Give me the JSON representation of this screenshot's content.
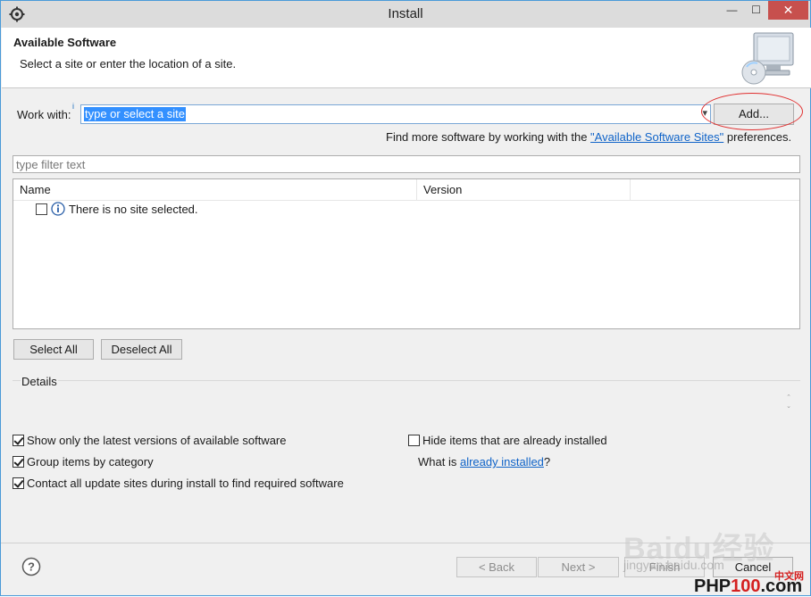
{
  "window": {
    "title": "Install",
    "min_glyph": "—",
    "max_glyph": "☐",
    "close_glyph": "✕"
  },
  "header": {
    "title": "Available Software",
    "subtitle": "Select a site or enter the location of a site."
  },
  "work_with": {
    "label": "Work with:",
    "info_glyph": "i",
    "value": "type or select a site",
    "arrow_glyph": "▾",
    "add_label": "Add..."
  },
  "find_more": {
    "prefix": "Find more software by working with the ",
    "link": "\"Available Software Sites\"",
    "suffix": " preferences."
  },
  "filter": {
    "placeholder": "type filter text"
  },
  "table": {
    "columns": [
      "Name",
      "Version"
    ],
    "rows": [
      {
        "text": "There is no site selected.",
        "checked": false,
        "icon": "info-icon"
      }
    ]
  },
  "selection_buttons": {
    "select_all": "Select All",
    "deselect_all": "Deselect All"
  },
  "details": {
    "label": "Details",
    "scroll_up": "⌃",
    "scroll_down": "⌄"
  },
  "options": {
    "latest_only": {
      "label": "Show only the latest versions of available software",
      "checked": true
    },
    "group_by_category": {
      "label": "Group items by category",
      "checked": true
    },
    "contact_sites": {
      "label": "Contact all update sites during install to find required software",
      "checked": true
    },
    "hide_installed": {
      "label": "Hide items that are already installed",
      "checked": false
    },
    "what_is": {
      "prefix": "What is ",
      "link": "already installed",
      "suffix": "?"
    }
  },
  "footer": {
    "help_glyph": "?",
    "back": "< Back",
    "next": "Next >",
    "finish": "Finish",
    "cancel": "Cancel"
  },
  "watermarks": {
    "baidu": "Baidu经验",
    "jingyan": "jingyan.baidu.com",
    "php_prefix": "PHP",
    "php_number": "100",
    "php_suffix": ".com",
    "php_cn": "中文网"
  },
  "colors": {
    "accent_blue": "#3390ff",
    "link_blue": "#0f63c8",
    "close_red": "#c7504d",
    "annotation_red": "#e03030"
  }
}
